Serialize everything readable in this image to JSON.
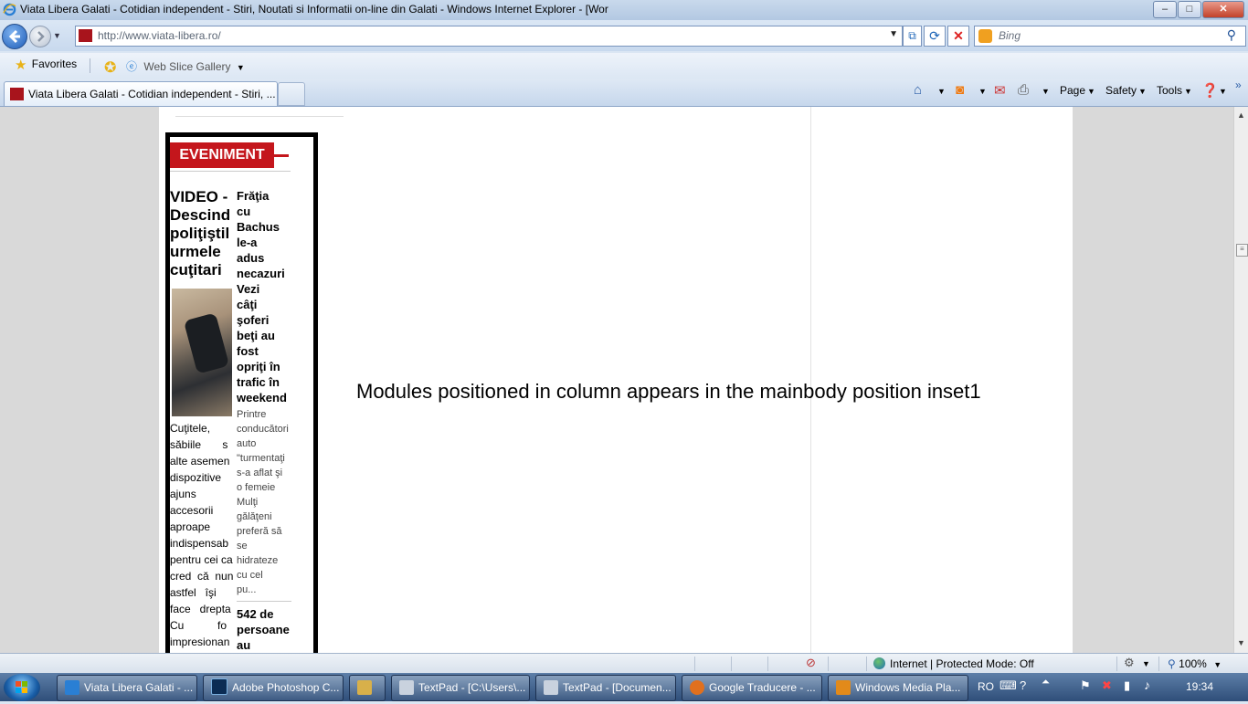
{
  "window": {
    "title": "Viata Libera Galati - Cotidian independent - Stiri, Noutati si Informatii on-line din Galati - Windows Internet Explorer - [Wor",
    "minimize": "–",
    "maximize": "□",
    "close": "✕"
  },
  "navigation": {
    "url": "http://www.viata-libera.ro/",
    "search_placeholder": "Bing"
  },
  "favorites_bar": {
    "favorites_label": "Favorites",
    "web_slice_label": "Web Slice Gallery"
  },
  "tab": {
    "label": "Viata Libera Galati - Cotidian independent - Stiri, ..."
  },
  "command_bar": {
    "page": "Page",
    "safety": "Safety",
    "tools": "Tools"
  },
  "content": {
    "section_heading": "EVENIMENT",
    "article1": {
      "title": "VIDEO -\nDescind\npoliţiştil\nurmele\ncuţitari",
      "body": "Cuţitele,\nsăbiile       s\nalte asemen\ndispozitive\najuns\naccesorii\naproape\nindispensab\npentru cei ca\ncred  că  nun\nastfel   îşi\nface   drepta\nCu           fo\nimpresionan"
    },
    "article2": {
      "title": "Frăţia\ncu\nBachus\nle-a\nadus\nnecazuri\nVezi\ncâţi\nşoferi\nbeţi au\nfost\nopriţi în\ntrafic în\nweekend",
      "body": "Printre\nconducători\nauto\n\"turmentaţi\ns-a aflat şi\no femeie\nMulţi\ngălăţeni\npreferă să\nse\nhidrateze\ncu cel\npu..."
    },
    "article3": {
      "title": "542 de\npersoane\nau"
    },
    "inset_message": "Modules positioned in column appears in the mainbody position inset1"
  },
  "status_bar": {
    "zone": "Internet | Protected Mode: Off",
    "zoom": "100%"
  },
  "taskbar": {
    "items": [
      {
        "label": "Viata Libera Galati - ...",
        "color": "#2a7fd4"
      },
      {
        "label": "Adobe Photoshop C...",
        "color": "#0b2c54"
      },
      {
        "label": "",
        "color": "#d8b04a"
      },
      {
        "label": "TextPad - [C:\\Users\\...",
        "color": "#c9d2de"
      },
      {
        "label": "TextPad - [Documen...",
        "color": "#c9d2de"
      },
      {
        "label": "Google Traducere - ...",
        "color": "#e0701e"
      },
      {
        "label": "Windows Media Pla...",
        "color": "#e28a1a"
      }
    ],
    "language": "RO",
    "clock": "19:34"
  }
}
